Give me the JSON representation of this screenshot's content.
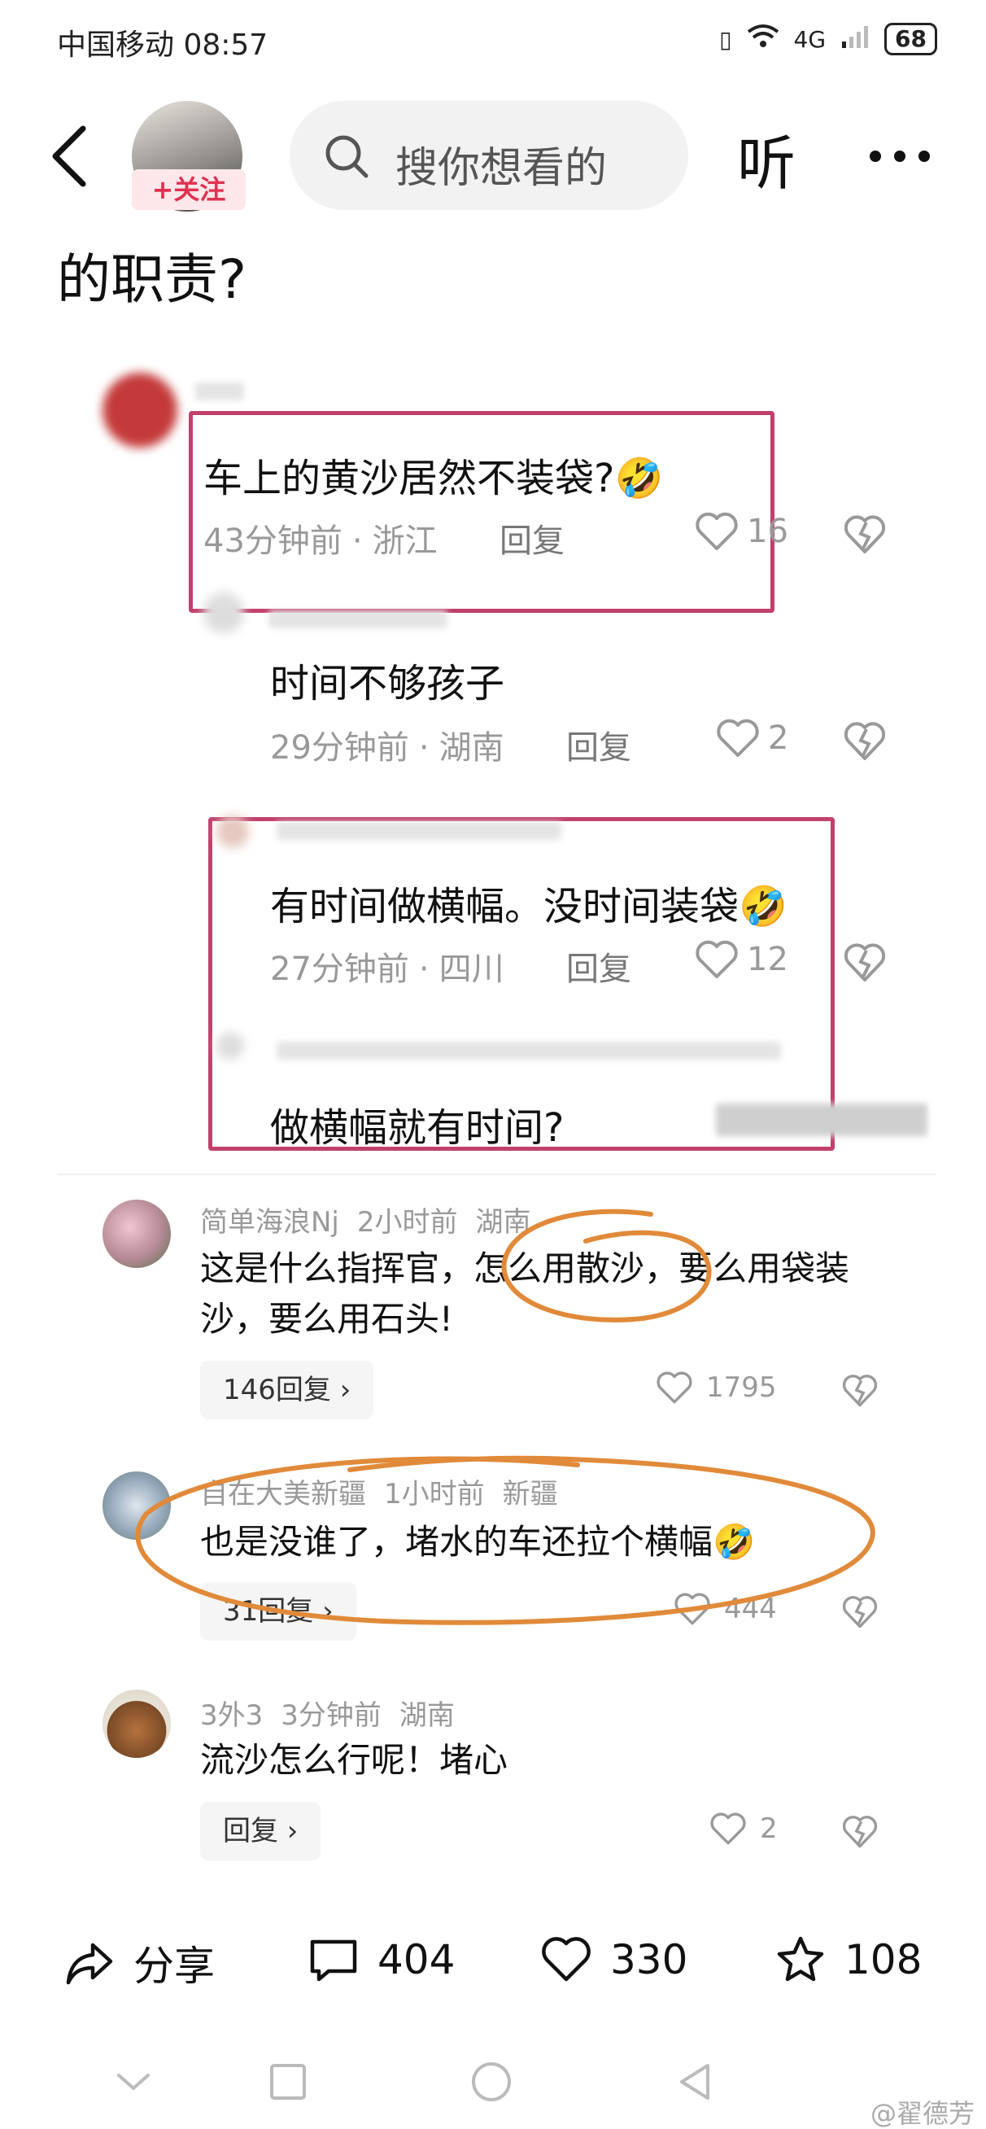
{
  "status_bar": {
    "carrier_time": "中国移动 08:57",
    "signal": "4G",
    "battery": "68"
  },
  "top_nav": {
    "follow_label": "+关注",
    "search_placeholder": "搜你想看的",
    "listen_label": "听"
  },
  "post_title_tail": "的职责?",
  "quoted_comments": [
    {
      "text": "车上的黄沙居然不装袋?",
      "emoji": "🤣",
      "time": "43分钟前",
      "location": "浙江",
      "reply_label": "回复",
      "likes": "16"
    },
    {
      "text": "时间不够孩子",
      "time": "29分钟前",
      "location": "湖南",
      "reply_label": "回复",
      "likes": "2"
    },
    {
      "text": "有时间做横幅。没时间装袋",
      "emoji": "🤣",
      "time": "27分钟前",
      "location": "四川",
      "reply_label": "回复",
      "likes": "12"
    },
    {
      "text": "做横幅就有时间?"
    }
  ],
  "comments": [
    {
      "user": "简单海浪Nj",
      "time": "2小时前",
      "location": "湖南",
      "text": "这是什么指挥官，怎么用散沙，要么用袋装沙，要么用石头!",
      "reply_count_label": "146回复 ›",
      "likes": "1795"
    },
    {
      "user": "自在大美新疆",
      "time": "1小时前",
      "location": "新疆",
      "text": "也是没谁了，堵水的车还拉个横幅🤣",
      "reply_count_label": "31回复 ›",
      "likes": "444"
    },
    {
      "user": "3外3",
      "time": "3分钟前",
      "location": "湖南",
      "text": "流沙怎么行呢！堵心",
      "reply_count_label": "回复 ›",
      "likes": "2"
    }
  ],
  "action_bar": {
    "share_label": "分享",
    "comment_count": "404",
    "like_count": "330",
    "favorite_count": "108"
  },
  "watermark": "@翟德芳",
  "colors": {
    "highlight_box": "#c2406d",
    "annotation_orange": "#e08a3a",
    "follow_red": "#e03150"
  }
}
